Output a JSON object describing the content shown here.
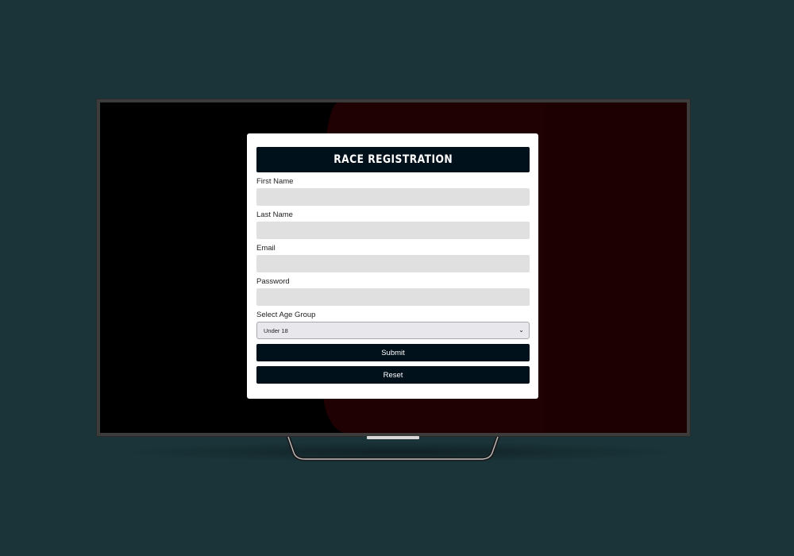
{
  "form": {
    "title": "RACE REGISTRATION",
    "fields": [
      {
        "label": "First Name",
        "value": "",
        "placeholder": ""
      },
      {
        "label": "Last Name",
        "value": "",
        "placeholder": ""
      },
      {
        "label": "Email",
        "value": "",
        "placeholder": ""
      },
      {
        "label": "Password",
        "value": "",
        "placeholder": ""
      }
    ],
    "age_group": {
      "label": "Select Age Group",
      "selected": "Under 18"
    },
    "submit_label": "Submit",
    "reset_label": "Reset"
  },
  "icons": {
    "select_arrow": "chevron-down-icon"
  },
  "colors": {
    "page_background": "#1a3439",
    "button_background": "#01111c",
    "input_background": "#e0e0e0",
    "screen_red": "#1f0003"
  }
}
